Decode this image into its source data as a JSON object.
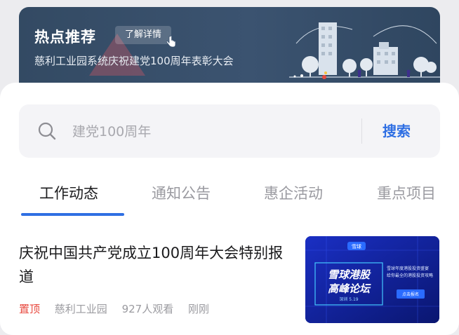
{
  "banner": {
    "title": "热点推荐",
    "detail_button": "了解详情",
    "subtitle": "慈利工业园系统庆祝建党100周年表彰大会",
    "hand_icon": "pointer-hand-icon",
    "accent": "#3b5370"
  },
  "search": {
    "placeholder": "建党100周年",
    "button_label": "搜索",
    "icon": "search-icon",
    "accent": "#2f6fe3"
  },
  "tabs": [
    {
      "label": "工作动态",
      "active": true
    },
    {
      "label": "通知公告",
      "active": false
    },
    {
      "label": "惠企活动",
      "active": false
    },
    {
      "label": "重点项目",
      "active": false
    }
  ],
  "article": {
    "title": "庆祝中国共产党成立100周年大会特别报道",
    "pin_label": "置顶",
    "source": "慈利工业园",
    "views": "927人观看",
    "time": "刚刚",
    "pin_color": "#e8493f",
    "thumbnail": {
      "logo": "雪球",
      "headline_line1": "雪球港股",
      "headline_line2": "高峰论坛",
      "date": "深圳 5.19",
      "desc_line1": "雪球年度港股投资盛宴",
      "desc_line2": "给你最全的港股投资攻略",
      "button": "点击报名"
    }
  }
}
